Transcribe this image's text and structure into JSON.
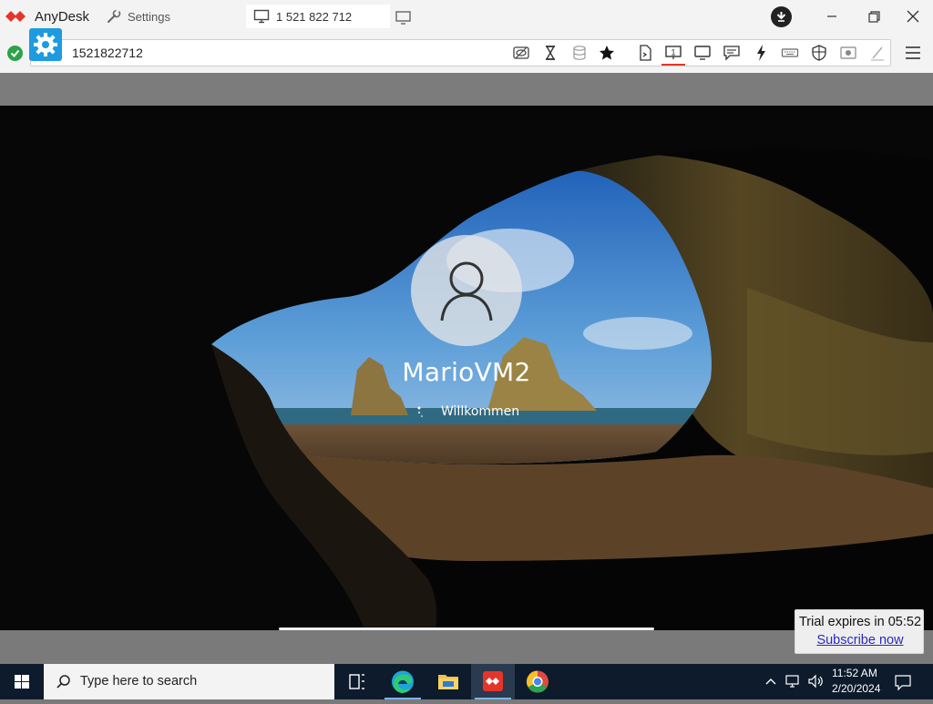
{
  "app": {
    "name": "AnyDesk",
    "brand_color": "#e4352b",
    "tabs": [
      {
        "label": "Settings",
        "icon": "wrench-icon"
      },
      {
        "label": "1 521 822 712",
        "icon": "monitor-icon"
      }
    ],
    "new_tab_icon": "new-session-monitor-icon"
  },
  "toolbar": {
    "address": "1521822712",
    "connection_status_icon": "check-circle-icon",
    "settings_icon": "gear-icon",
    "icons": [
      "privacy-eye-icon",
      "hourglass-icon",
      "database-icon",
      "star-icon",
      "file-transfer-icon",
      "monitor-1-icon",
      "display-icon",
      "chat-icon",
      "lightning-icon",
      "keyboard-icon",
      "shield-icon",
      "record-icon",
      "pen-icon",
      "hamburger-menu-icon"
    ]
  },
  "remote": {
    "username": "MarioVM2",
    "welcome_text": "Willkommen"
  },
  "trial": {
    "text": "Trial expires in 05:52",
    "link": "Subscribe now"
  },
  "taskbar": {
    "search_placeholder": "Type here to search",
    "apps": [
      "task-view-icon",
      "edge-icon",
      "file-explorer-icon",
      "anydesk-icon",
      "chrome-icon"
    ],
    "time": "11:52 AM",
    "date": "2/20/2024"
  },
  "colors": {
    "accent_blue": "#1e9be0",
    "status_green": "#2ca24a",
    "taskbar_bg": "#0d1b2c"
  }
}
